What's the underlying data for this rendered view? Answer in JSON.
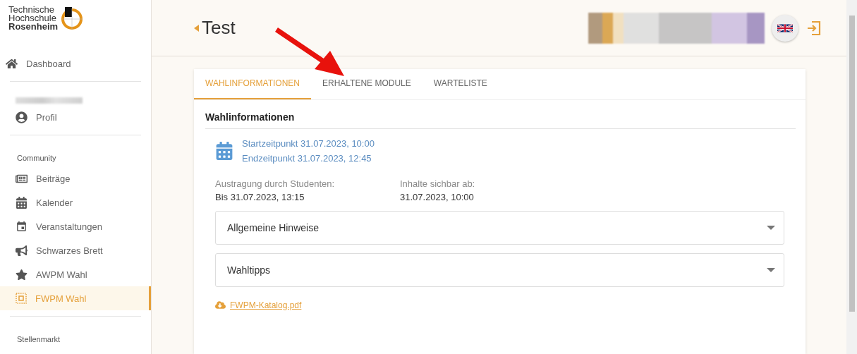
{
  "logo": {
    "lines": [
      "Technische",
      "Hochschule",
      "Rosenheim"
    ]
  },
  "sidebar": {
    "sections": [
      {
        "items": [
          {
            "label": "Dashboard",
            "selected": false
          }
        ]
      },
      {
        "user_blurred": true,
        "items": [
          {
            "label": "Profil",
            "selected": false
          }
        ]
      },
      {
        "heading": "Community",
        "items": [
          {
            "label": "Beiträge",
            "selected": false
          },
          {
            "label": "Kalender",
            "selected": false
          },
          {
            "label": "Veranstaltungen",
            "selected": false
          },
          {
            "label": "Schwarzes Brett",
            "selected": false
          },
          {
            "label": "AWPM Wahl",
            "selected": false
          },
          {
            "label": "FWPM Wahl",
            "selected": true
          }
        ]
      },
      {
        "heading": "Stellenmarkt"
      }
    ]
  },
  "header": {
    "title": "Test"
  },
  "tabs": [
    {
      "label": "WAHLINFORMATIONEN",
      "selected": true
    },
    {
      "label": "ERHALTENE MODULE",
      "selected": false
    },
    {
      "label": "WARTELISTE",
      "selected": false
    }
  ],
  "section_title": "Wahlinformationen",
  "dates": [
    "Startzeitpunkt 31.07.2023, 10:00",
    "Endzeitpunkt 31.07.2023, 12:45"
  ],
  "facts": [
    {
      "label": "Austragung durch Studenten:",
      "value": "Bis 31.07.2023, 13:15"
    },
    {
      "label": "Inhalte sichbar ab:",
      "value": "31.07.2023, 10:00"
    }
  ],
  "accordions": [
    {
      "label": "Allgemeine Hinweise",
      "expanded": false
    },
    {
      "label": "Wahltipps",
      "expanded": false
    }
  ],
  "file_link": "FWPM-Katalog.pdf"
}
